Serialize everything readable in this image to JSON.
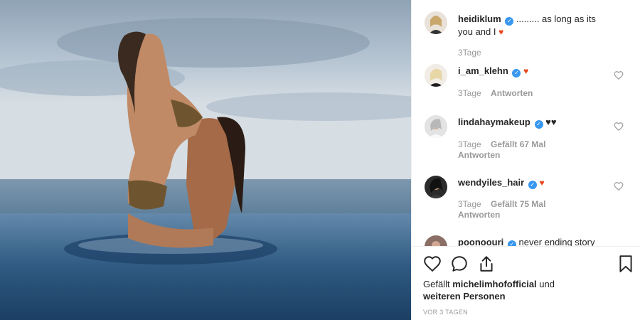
{
  "post": {
    "author": "heidiklum",
    "caption": "......... as long as its you and I",
    "caption_emoji": "heart-emoji",
    "age": "3Tage"
  },
  "comments": [
    {
      "user": "i_am_klehn",
      "verified": true,
      "text": "",
      "emoji": "heart-emoji",
      "age": "3Tage",
      "likes": "",
      "reply": "Antworten"
    },
    {
      "user": "lindahaymakeup",
      "verified": true,
      "text": "♥♥",
      "emoji": "",
      "age": "3Tage",
      "likes": "Gefällt 67 Mal",
      "reply": "Antworten"
    },
    {
      "user": "wendyiles_hair",
      "verified": true,
      "text": "",
      "emoji": "heart-emoji",
      "age": "3Tage",
      "likes": "Gefällt 75 Mal",
      "reply": "Antworten"
    },
    {
      "user": "poonoouri",
      "verified": true,
      "text": "never ending story",
      "emoji": ""
    }
  ],
  "actions": {
    "liked_by_prefix": "Gefällt",
    "liked_by_user": "michelimhofofficial",
    "liked_by_and": "und",
    "liked_by_others": "weiteren Personen",
    "date": "VOR 3 TAGEN",
    "icons": [
      "heart-icon",
      "comment-icon",
      "share-icon",
      "bookmark-icon"
    ]
  },
  "colors": {
    "verified": "#3897f0",
    "meta_text": "#999999",
    "text": "#262626",
    "heart_emoji": "#e8451c"
  }
}
